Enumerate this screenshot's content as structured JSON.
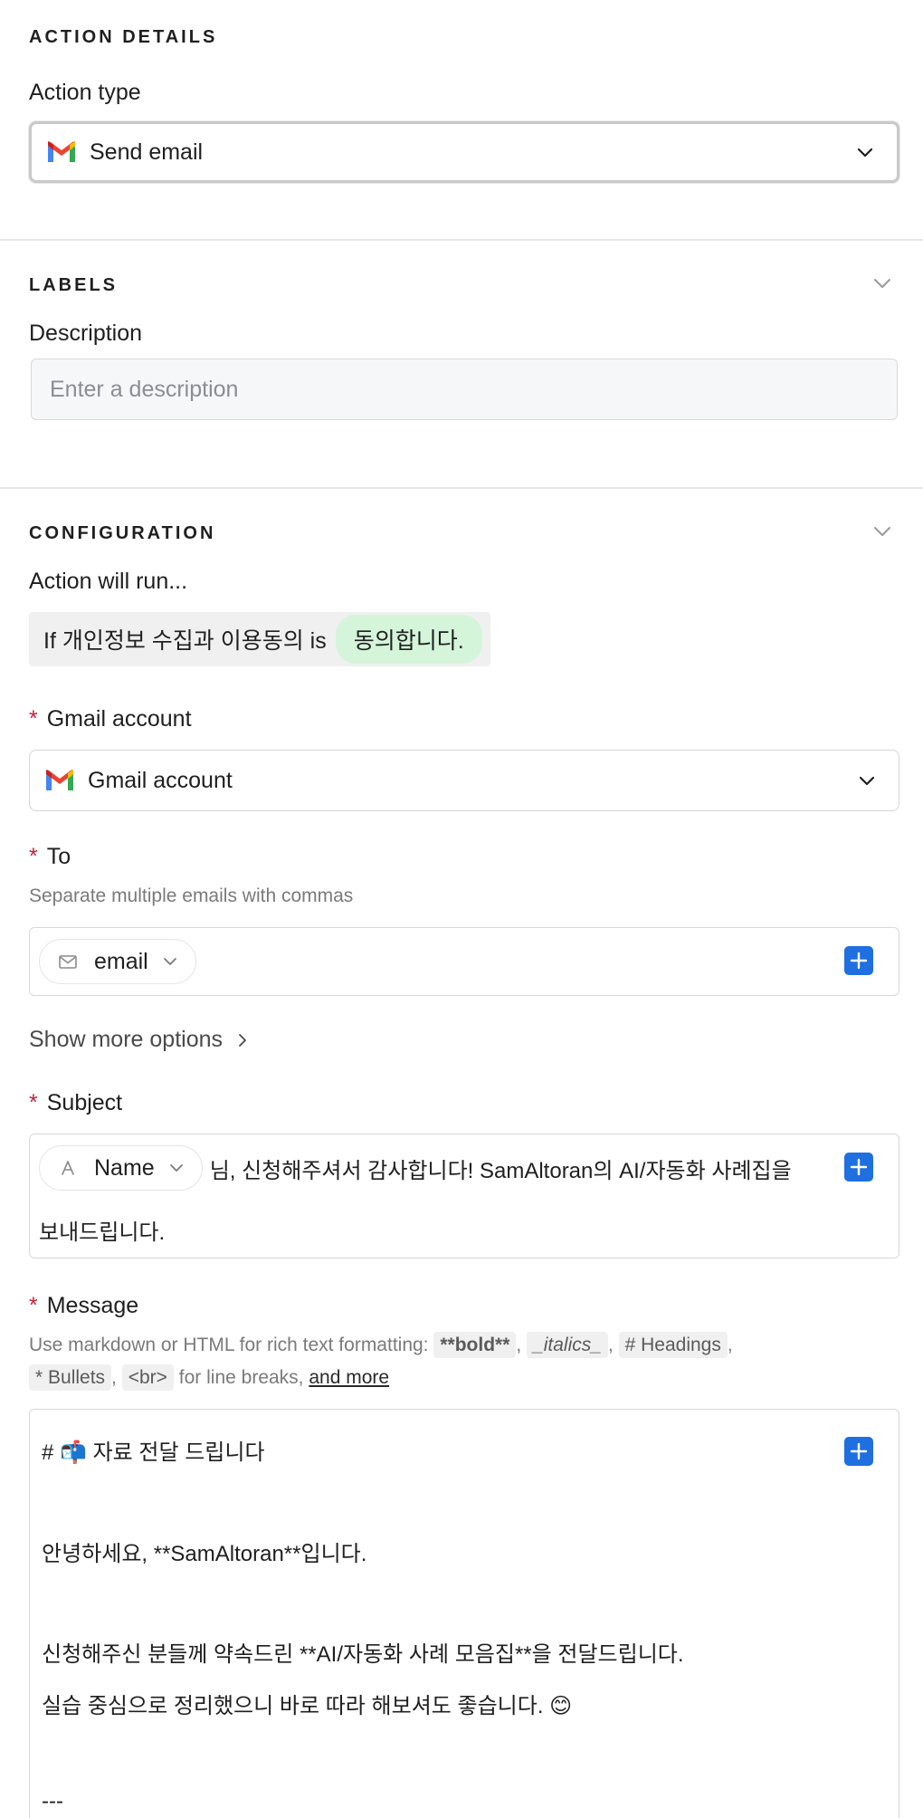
{
  "action_details": {
    "section_title": "ACTION DETAILS",
    "action_type_label": "Action type",
    "action_type_value": "Send email"
  },
  "labels": {
    "section_title": "LABELS",
    "description_label": "Description",
    "description_placeholder": "Enter a description"
  },
  "configuration": {
    "section_title": "CONFIGURATION",
    "run_label": "Action will run...",
    "condition_prefix": "If 개인정보 수집과 이용동의 is",
    "condition_value": "동의합니다.",
    "gmail_account": {
      "required_mark": "*",
      "label": "Gmail account",
      "value": "Gmail account"
    },
    "to": {
      "required_mark": "*",
      "label": "To",
      "hint": "Separate multiple emails with commas",
      "token_label": "email"
    },
    "show_more_label": "Show more options",
    "subject": {
      "required_mark": "*",
      "label": "Subject",
      "token_label": "Name",
      "text_line1": "님, 신청해주셔서 감사합니다! SamAltoran의 AI/자동화 사례집을",
      "text_line2": "보내드립니다."
    },
    "message": {
      "required_mark": "*",
      "label": "Message",
      "hint_prefix": "Use markdown or HTML for rich text formatting:",
      "code_bold": "**bold**",
      "code_italics": "_italics_",
      "code_headings": "# Headings",
      "code_bullets": "* Bullets",
      "code_br": "<br>",
      "hint_linebreaks": "for line breaks,",
      "hint_link": "and more",
      "comma": ",",
      "lines": [
        "# 📬 자료 전달 드립니다",
        "안녕하세요, **SamAltoran**입니다.",
        "신청해주신 분들께 약속드린 **AI/자동화 사례 모음집**을 전달드립니다.",
        "실습 중심으로 정리했으니 바로 따라 해보셔도 좋습니다. 😊",
        "---"
      ]
    }
  },
  "colors": {
    "primary": "#1f6fe0",
    "required": "#c4223a",
    "condition_pill": "#d5f5da"
  }
}
